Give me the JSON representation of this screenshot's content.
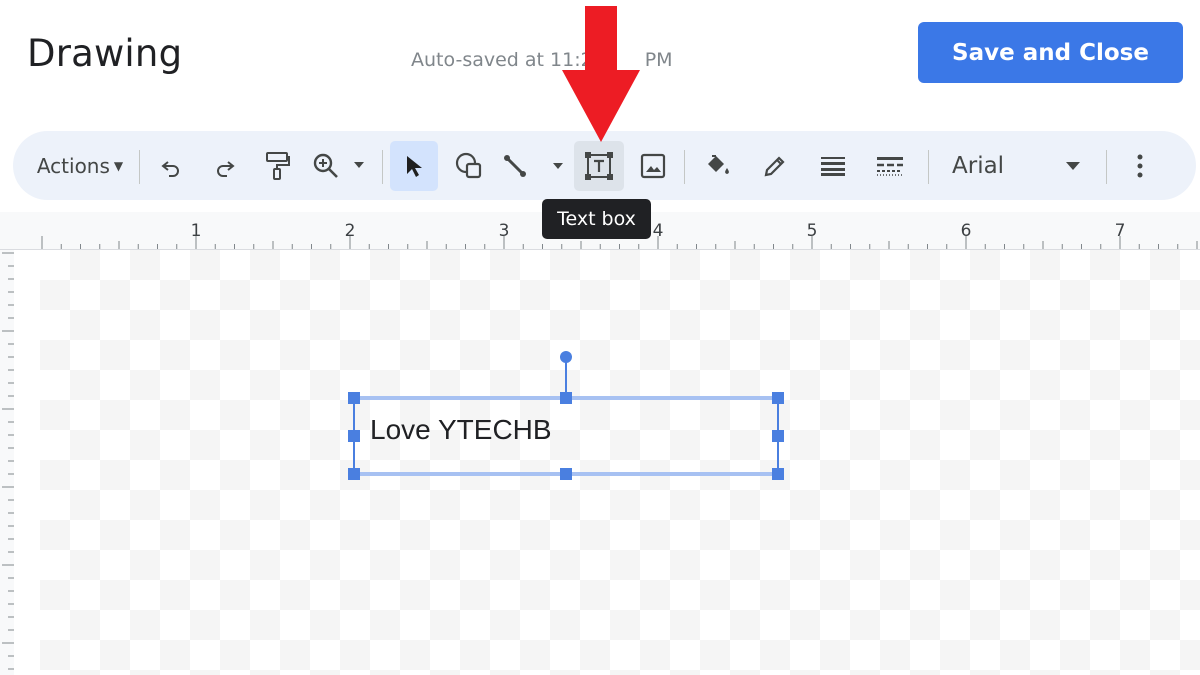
{
  "header": {
    "title": "Drawing",
    "autosave": "Auto-saved at 11:2",
    "autosave_tail": "PM",
    "save_label": "Save and Close"
  },
  "toolbar": {
    "actions_label": "Actions",
    "font": "Arial",
    "icons": [
      "undo-icon",
      "redo-icon",
      "paint-format-icon",
      "zoom-icon",
      "select-icon",
      "shape-icon",
      "line-icon",
      "text-box-icon",
      "image-icon",
      "fill-color-icon",
      "border-color-icon",
      "border-weight-icon",
      "border-dash-icon",
      "more-icon"
    ]
  },
  "tooltip": "Text box",
  "ruler": {
    "labels": [
      "1",
      "2",
      "3",
      "4",
      "5",
      "6",
      "7"
    ]
  },
  "textbox": {
    "text": "Love YTECHB"
  },
  "colors": {
    "accent": "#3b78e7",
    "arrow": "#ed1c24",
    "selection": "#4a7fe0"
  }
}
